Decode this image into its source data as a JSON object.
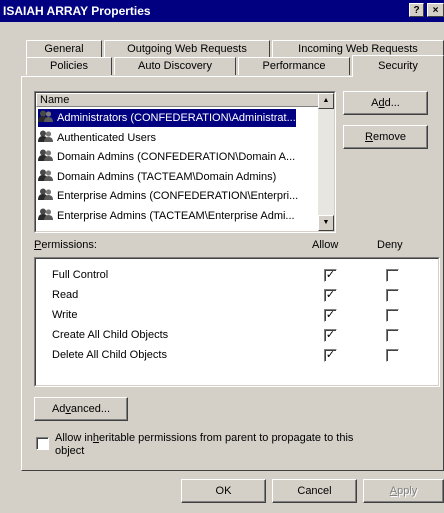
{
  "window": {
    "title": "ISAIAH ARRAY Properties",
    "help_btn": "?",
    "close_btn": "×"
  },
  "tabs_back": [
    "General",
    "Outgoing Web Requests",
    "Incoming Web Requests"
  ],
  "tabs_front": [
    "Policies",
    "Auto Discovery",
    "Performance",
    "Security"
  ],
  "names": {
    "header": "Name",
    "items": [
      "Administrators (CONFEDERATION\\Administrat...",
      "Authenticated Users",
      "Domain Admins (CONFEDERATION\\Domain A...",
      "Domain Admins (TACTEAM\\Domain Admins)",
      "Enterprise Admins (CONFEDERATION\\Enterpri...",
      "Enterprise Admins (TACTEAM\\Enterprise Admi..."
    ],
    "selected_index": 0
  },
  "buttons": {
    "add_pre": "A",
    "add_u": "d",
    "add_post": "d...",
    "remove_u": "R",
    "remove_post": "emove",
    "advanced_pre": "Ad",
    "advanced_u": "v",
    "advanced_post": "anced...",
    "ok": "OK",
    "cancel": "Cancel",
    "apply_u": "A",
    "apply_post": "pply"
  },
  "permissions": {
    "label_u": "P",
    "label_post": "ermissions:",
    "allow_header": "Allow",
    "deny_header": "Deny",
    "rows": [
      {
        "name": "Full Control",
        "allow": true,
        "deny": false
      },
      {
        "name": "Read",
        "allow": true,
        "deny": false
      },
      {
        "name": "Write",
        "allow": true,
        "deny": false
      },
      {
        "name": "Create All Child Objects",
        "allow": true,
        "deny": false
      },
      {
        "name": "Delete All Child Objects",
        "allow": true,
        "deny": false
      }
    ]
  },
  "inherit": {
    "pre": "Allow in",
    "u": "h",
    "post": "eritable permissions from parent to propagate to this",
    "line2": "object",
    "checked": false
  },
  "colors": {
    "titlebar": "#000080",
    "face": "#d4d0c8",
    "selection": "#000080"
  }
}
